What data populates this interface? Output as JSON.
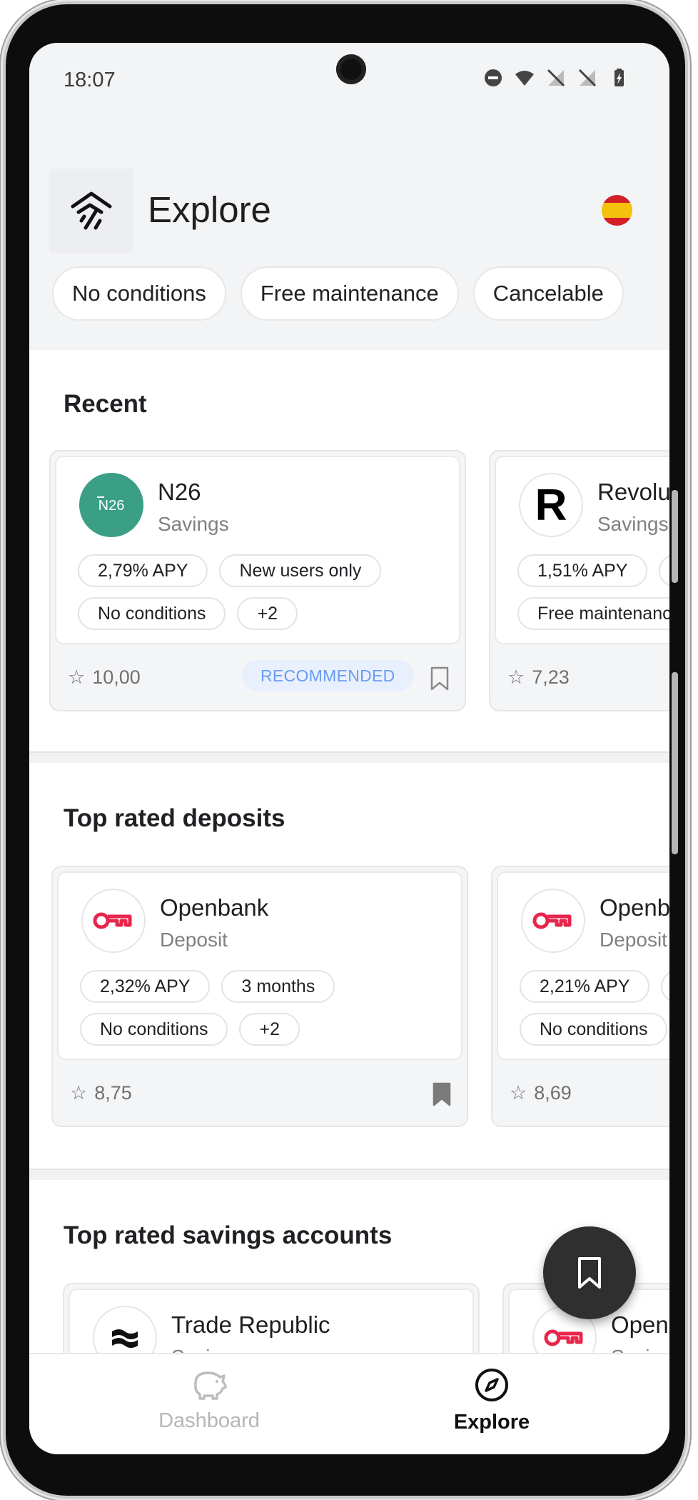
{
  "status_bar": {
    "time": "18:07"
  },
  "header": {
    "title": "Explore"
  },
  "filters": [
    "No conditions",
    "Free maintenance",
    "Cancelable"
  ],
  "sections": [
    {
      "title": "Recent",
      "cards": [
        {
          "name": "N26",
          "type": "Savings",
          "tags_row1": [
            "2,79% APY",
            "New users only"
          ],
          "tags_row2": [
            "No conditions",
            "+2"
          ],
          "rating": "10,00",
          "badge": "RECOMMENDED",
          "bookmarked": false
        },
        {
          "name": "Revolut",
          "type": "Savings",
          "tags_row1": [
            "1,51% APY"
          ],
          "tags_row2": [
            "Free maintenance"
          ],
          "rating": "7,23"
        }
      ]
    },
    {
      "title": "Top rated deposits",
      "cards": [
        {
          "name": "Openbank",
          "type": "Deposit",
          "tags_row1": [
            "2,32% APY",
            "3 months"
          ],
          "tags_row2": [
            "No conditions",
            "+2"
          ],
          "rating": "8,75",
          "bookmarked": true
        },
        {
          "name": "Openbank",
          "type": "Deposit",
          "tags_row1": [
            "2,21% APY"
          ],
          "tags_row2": [
            "No conditions"
          ],
          "rating": "8,69"
        }
      ]
    },
    {
      "title": "Top rated savings accounts",
      "cards": [
        {
          "name": "Trade Republic",
          "type": "Savings"
        },
        {
          "name": "Openbank",
          "type": "Savings"
        }
      ]
    }
  ],
  "bottom_nav": {
    "dashboard": "Dashboard",
    "explore": "Explore",
    "active": "explore"
  },
  "icons": {
    "logo": "app-logo-icon",
    "flag": "spain-flag-icon",
    "fab": "bookmark-icon",
    "nav_dashboard": "piggy-bank-icon",
    "nav_explore": "compass-icon"
  },
  "colors": {
    "n26_green": "#3a9f85",
    "openbank_red": "#e8254b",
    "recommended_bg": "#e8f0fe",
    "recommended_text": "#6a9bf0",
    "fab": "#2f2f2f"
  }
}
